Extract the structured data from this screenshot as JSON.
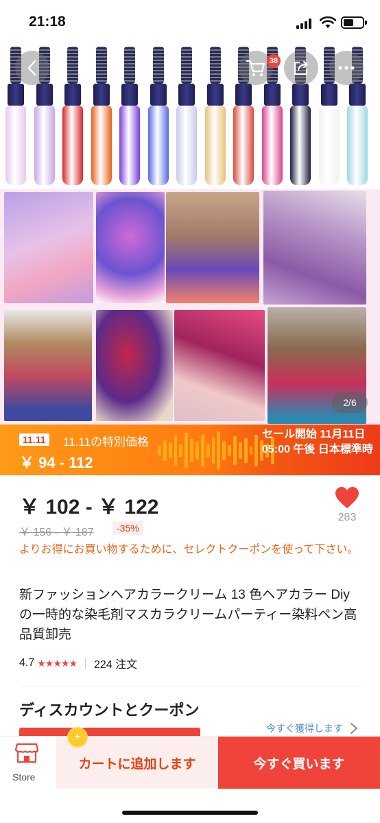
{
  "status_bar": {
    "time": "21:18"
  },
  "hero": {
    "cart_count": "38",
    "pager": "2/6",
    "tube_colors": [
      "#e8c8ec",
      "#c9a6e8",
      "#d8262a",
      "#e8601e",
      "#7a3ee0",
      "#5c6ae6",
      "#c8cbe8",
      "#e8c27a",
      "#d94a3a",
      "#d8458a",
      "#1f1f3e",
      "#f2f2f4",
      "#9ed8e0"
    ]
  },
  "sale": {
    "tag": "11.11",
    "tag_title": "11.11の特別価格",
    "range": "￥ 94 - 112",
    "start": "セール開始 11月11日 05:00 午後 日本標準時"
  },
  "price": {
    "current": "￥ 102 - ￥ 122",
    "likes": "283",
    "original": "￥ 156 - ￥ 187",
    "discount": "-35%",
    "coupon_msg": "よりお得にお買い物するために、セレクトクーポンを使って下さい。"
  },
  "product": {
    "title": "新ファッションヘアカラークリーム 13 色ヘアカラー Diy の一時的な染毛剤マスカラクリームパーティー染料ペン高品質卸売",
    "rating": "4.7",
    "orders": "224 注文"
  },
  "discounts": {
    "title": "ディスカウントとクーポン",
    "get_now": "今すぐ獲得します"
  },
  "bottom": {
    "store_label": "Store",
    "cart_label": "カートに追加します",
    "buy_label": "今すぐ買います"
  }
}
